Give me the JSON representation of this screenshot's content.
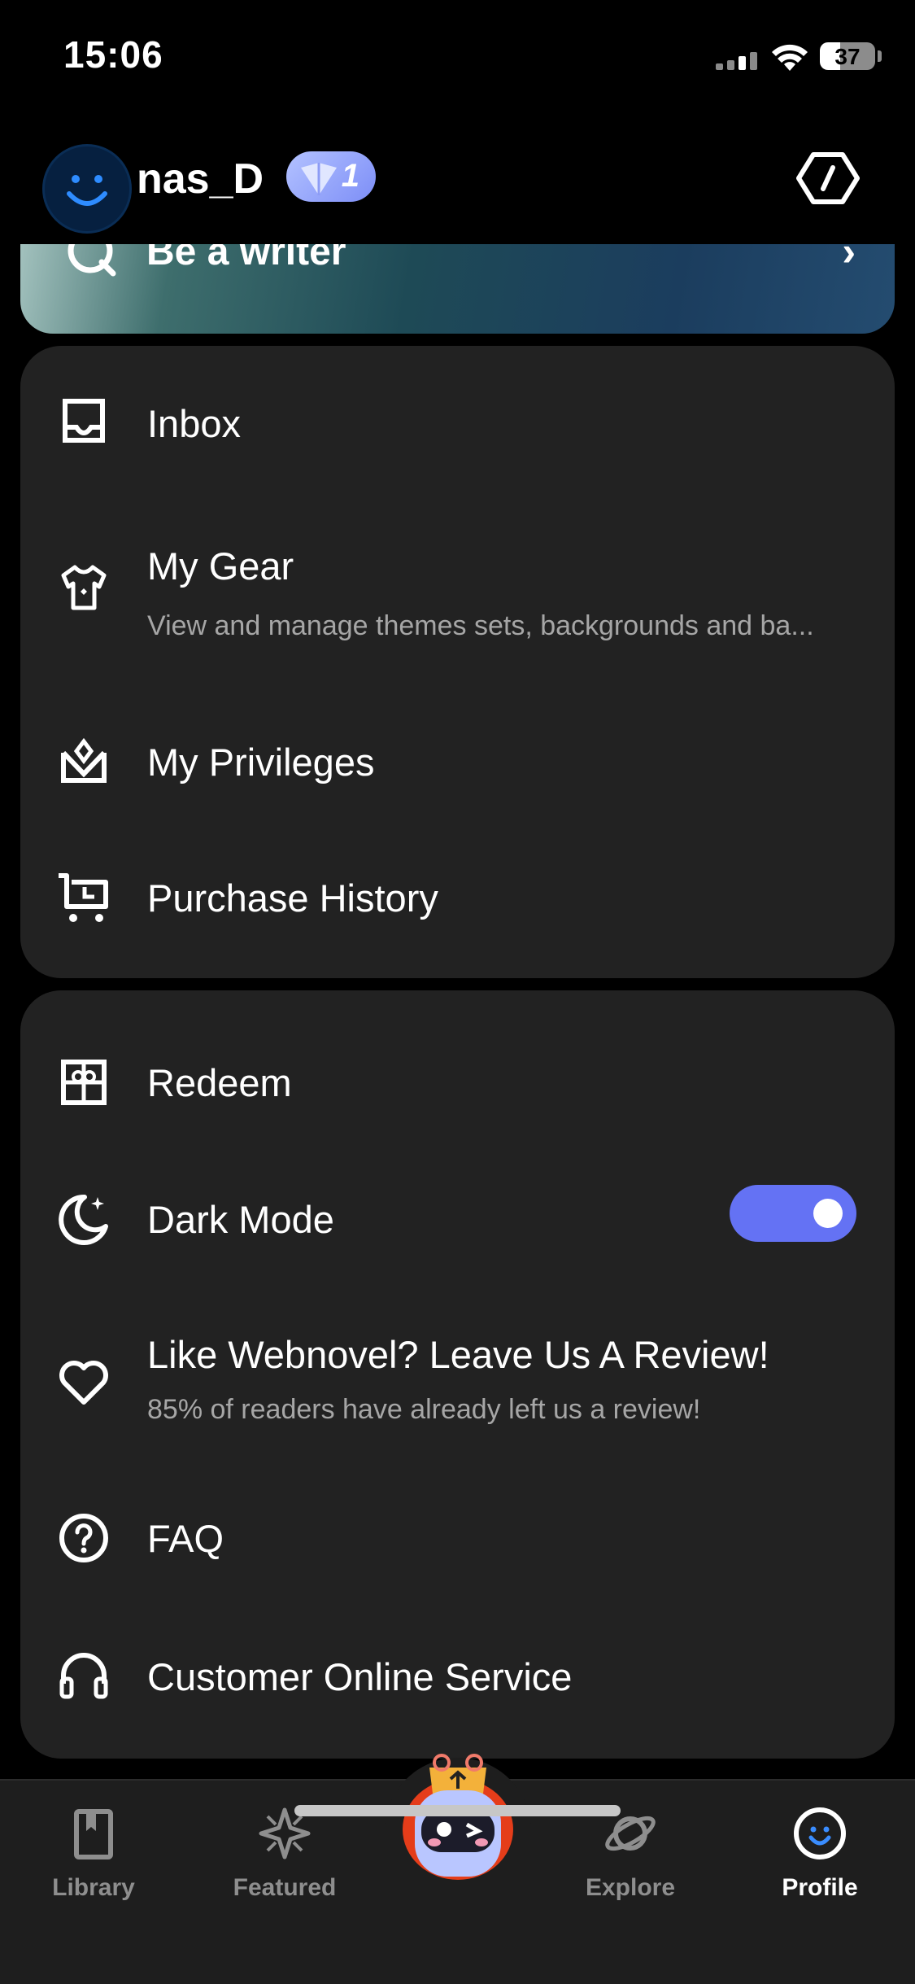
{
  "status_bar": {
    "time": "15:06",
    "battery": "37"
  },
  "header": {
    "username": "nas_D",
    "level_badge": "1"
  },
  "banner": {
    "title": "Be a writer",
    "chevron": "›"
  },
  "menu_group_1": [
    {
      "icon": "inbox-icon",
      "title": "Inbox"
    },
    {
      "icon": "tshirt-icon",
      "title": "My Gear",
      "subtitle": "View and manage themes sets, backgrounds and ba..."
    },
    {
      "icon": "crown-icon",
      "title": "My Privileges"
    },
    {
      "icon": "cart-icon",
      "title": "Purchase History"
    }
  ],
  "menu_group_2": [
    {
      "icon": "gift-icon",
      "title": "Redeem"
    },
    {
      "icon": "moon-icon",
      "title": "Dark Mode",
      "toggle_on": true
    },
    {
      "icon": "heart-icon",
      "title": "Like Webnovel? Leave Us A Review!",
      "subtitle": "85% of readers have already left us a review!"
    },
    {
      "icon": "question-icon",
      "title": "FAQ"
    },
    {
      "icon": "headset-icon",
      "title": "Customer Online Service"
    }
  ],
  "tabbar": {
    "tabs": [
      {
        "label": "Library",
        "icon": "book-icon",
        "active": false
      },
      {
        "label": "Featured",
        "icon": "sparkle-icon",
        "active": false
      },
      {
        "label": "Explore",
        "icon": "planet-icon",
        "active": false
      },
      {
        "label": "Profile",
        "icon": "smiley-icon",
        "active": true
      }
    ]
  },
  "colors": {
    "accent": "#6472f4",
    "card_bg": "#222222",
    "background": "#000000"
  }
}
